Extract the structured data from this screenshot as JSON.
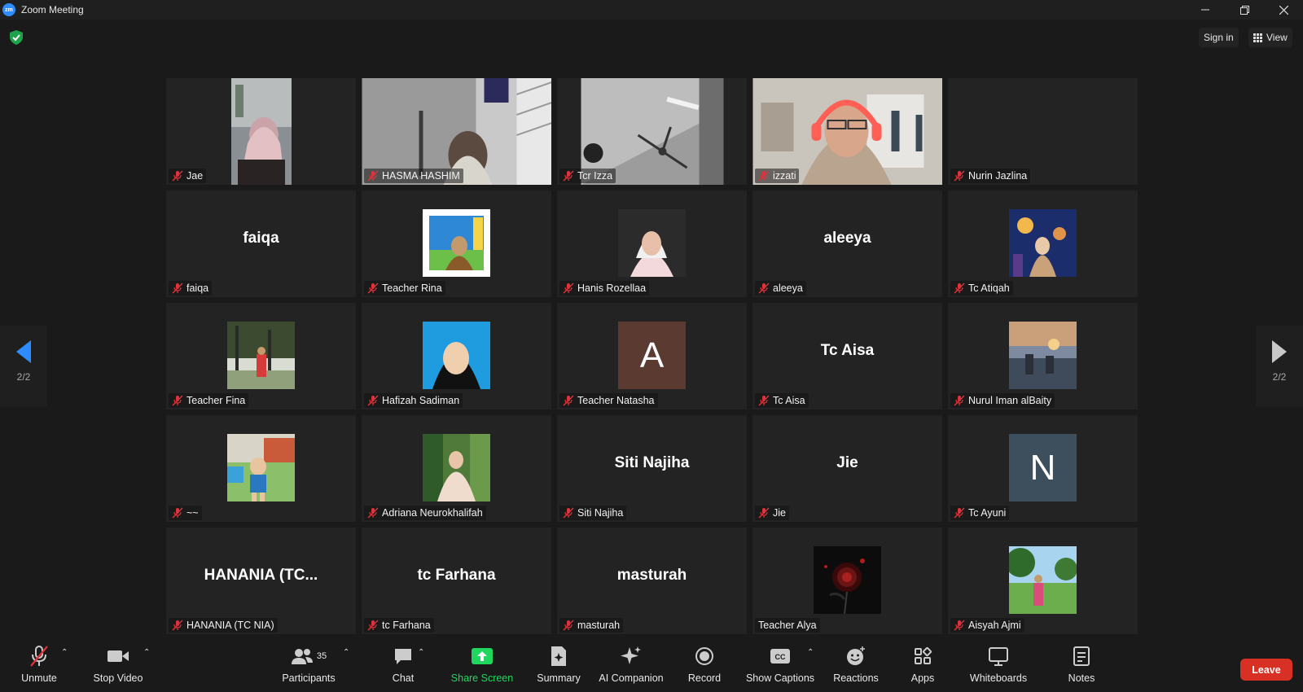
{
  "window": {
    "logo": "zm",
    "title": "Zoom Meeting",
    "controls": [
      "minimize-icon",
      "restore-icon",
      "close-icon"
    ]
  },
  "topbar": {
    "security_icon": "shield-check-icon",
    "signin_label": "Sign in",
    "view_label": "View"
  },
  "nav": {
    "prev_page": "2/2",
    "next_page": "2/2"
  },
  "tiles": [
    {
      "name": "Jae",
      "kind": "video",
      "muted": true
    },
    {
      "name": "HASMA HASHIM",
      "kind": "video",
      "muted": true
    },
    {
      "name": "Tcr Izza",
      "kind": "video",
      "muted": true
    },
    {
      "name": "izzati",
      "kind": "video",
      "muted": true
    },
    {
      "name": "Nurin Jazlina",
      "kind": "blank",
      "muted": true
    },
    {
      "name": "faiqa",
      "kind": "name",
      "display": "faiqa",
      "muted": true
    },
    {
      "name": "Teacher Rina",
      "kind": "avatar",
      "muted": true
    },
    {
      "name": "Hanis Rozellaa",
      "kind": "avatar",
      "muted": true
    },
    {
      "name": "aleeya",
      "kind": "name",
      "display": "aleeya",
      "muted": true
    },
    {
      "name": "Tc Atiqah",
      "kind": "avatar",
      "muted": true
    },
    {
      "name": "Teacher Fina",
      "kind": "avatar",
      "muted": true
    },
    {
      "name": "Hafizah Sadiman",
      "kind": "avatar",
      "muted": true
    },
    {
      "name": "Teacher Natasha",
      "kind": "letter",
      "letter": "A",
      "color": "#5b3a32",
      "muted": true
    },
    {
      "name": "Tc Aisa",
      "kind": "name",
      "display": "Tc Aisa",
      "muted": true
    },
    {
      "name": "Nurul Iman alBaity",
      "kind": "avatar",
      "muted": true
    },
    {
      "name": "~~",
      "kind": "avatar",
      "muted": true
    },
    {
      "name": "Adriana Neurokhalifah",
      "kind": "avatar",
      "muted": true
    },
    {
      "name": "Siti Najiha",
      "kind": "name",
      "display": "Siti Najiha",
      "muted": true
    },
    {
      "name": "Jie",
      "kind": "name",
      "display": "Jie",
      "muted": true
    },
    {
      "name": "Tc Ayuni",
      "kind": "letter",
      "letter": "N",
      "color": "#3d4f5c",
      "muted": true
    },
    {
      "name": "HANANIA (TC NIA)",
      "kind": "name",
      "display": "HANANIA  (TC...",
      "muted": true
    },
    {
      "name": "tc Farhana",
      "kind": "name",
      "display": "tc Farhana",
      "muted": true
    },
    {
      "name": "masturah",
      "kind": "name",
      "display": "masturah",
      "muted": true
    },
    {
      "name": "Teacher Alya",
      "kind": "avatar",
      "muted": false
    },
    {
      "name": "Aisyah Ajmi",
      "kind": "avatar",
      "muted": true
    }
  ],
  "toolbar": {
    "unmute": "Unmute",
    "stop_video": "Stop Video",
    "participants": "Participants",
    "participant_count": "35",
    "chat": "Chat",
    "share_screen": "Share Screen",
    "summary": "Summary",
    "ai_companion": "AI Companion",
    "record": "Record",
    "show_captions": "Show Captions",
    "cc": "CC",
    "reactions": "Reactions",
    "apps": "Apps",
    "whiteboards": "Whiteboards",
    "notes": "Notes",
    "leave": "Leave"
  },
  "colors": {
    "accent": "#2d8cff",
    "share": "#1fd65f",
    "leave": "#d93025",
    "muted": "#e0323b",
    "tile_bg": "#232323"
  }
}
